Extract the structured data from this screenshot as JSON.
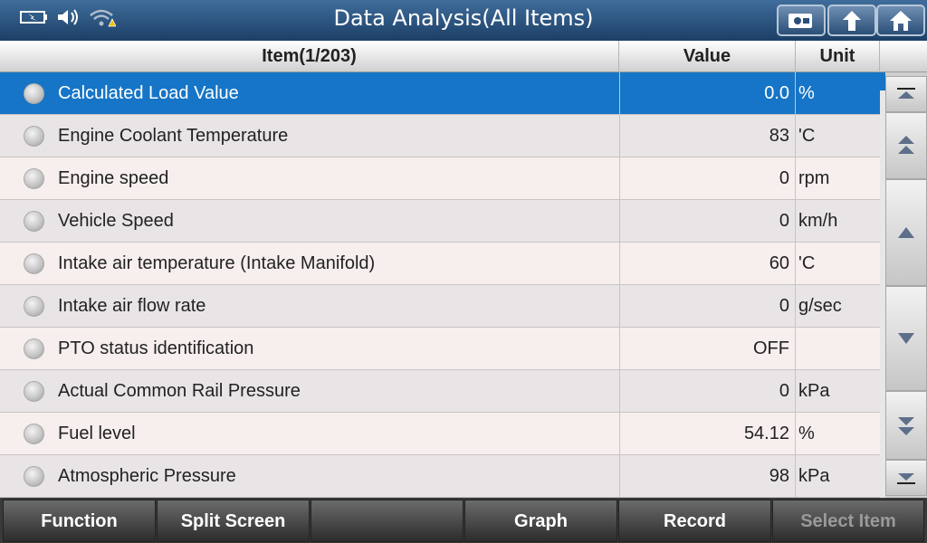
{
  "title": "Data Analysis(All Items)",
  "status_icons": [
    "battery-icon",
    "volume-icon",
    "wifi-warning-icon"
  ],
  "toolbar_icons": [
    "screenshot-icon",
    "back-icon",
    "home-icon"
  ],
  "header": {
    "item": "Item(1/203)",
    "value": "Value",
    "unit": "Unit"
  },
  "rows": [
    {
      "name": "Calculated Load Value",
      "value": "0.0",
      "unit": "%"
    },
    {
      "name": "Engine Coolant Temperature",
      "value": "83",
      "unit": "'C"
    },
    {
      "name": "Engine speed",
      "value": "0",
      "unit": "rpm"
    },
    {
      "name": "Vehicle Speed",
      "value": "0",
      "unit": "km/h"
    },
    {
      "name": "Intake air temperature (Intake Manifold)",
      "value": "60",
      "unit": "'C"
    },
    {
      "name": "Intake air flow rate",
      "value": "0",
      "unit": "g/sec"
    },
    {
      "name": "PTO status identification",
      "value": "OFF",
      "unit": ""
    },
    {
      "name": "Actual Common Rail Pressure",
      "value": "0",
      "unit": "kPa"
    },
    {
      "name": "Fuel level",
      "value": "54.12",
      "unit": "%"
    },
    {
      "name": "Atmospheric Pressure",
      "value": "98",
      "unit": "kPa"
    }
  ],
  "bottom": {
    "function": "Function",
    "split": "Split Screen",
    "empty": "",
    "graph": "Graph",
    "record": "Record",
    "select": "Select Item"
  },
  "colors": {
    "accent": "#1675c6",
    "titlebar": "#2b4f78"
  }
}
